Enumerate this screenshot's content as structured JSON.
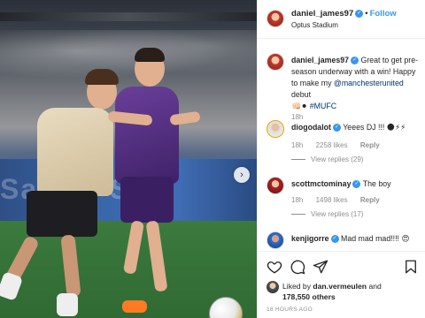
{
  "post": {
    "username": "daniel_james97",
    "follow_separator": "•",
    "follow_label": "Follow",
    "location": "Optus Stadium",
    "photo_banner_text": "Sams2 S",
    "next_glyph": "›"
  },
  "caption": {
    "username": "daniel_james97",
    "text_part1": " Great to get pre-season underway with a win! Happy to make my ",
    "mention": "@manchesterunited",
    "text_part2": " debut",
    "emojis": "👊🏻⚫",
    "hashtag": "#MUFC",
    "time": "18h"
  },
  "comments": [
    {
      "username": "diogodalot",
      "text": " Yeees DJ !!! 🌑⚡⚡",
      "time": "18h",
      "likes": "2258 likes",
      "reply": "Reply",
      "view_replies": "View replies (29)"
    },
    {
      "username": "scottmctominay",
      "text": " The boy",
      "time": "18h",
      "likes": "1498 likes",
      "reply": "Reply",
      "view_replies": "View replies (17)"
    },
    {
      "username": "kenjigorre",
      "text": " Mad mad mad!!!! 😍",
      "time": "",
      "likes": "",
      "reply": "",
      "view_replies": ""
    }
  ],
  "likes": {
    "prefix": "Liked by ",
    "user": "dan.vermeulen",
    "middle": " and",
    "count": "178,550 others"
  },
  "timestamp": "18 HOURS AGO",
  "colors": {
    "accent": "#3897f0",
    "muted": "#8e8e8e",
    "text": "#262626"
  }
}
